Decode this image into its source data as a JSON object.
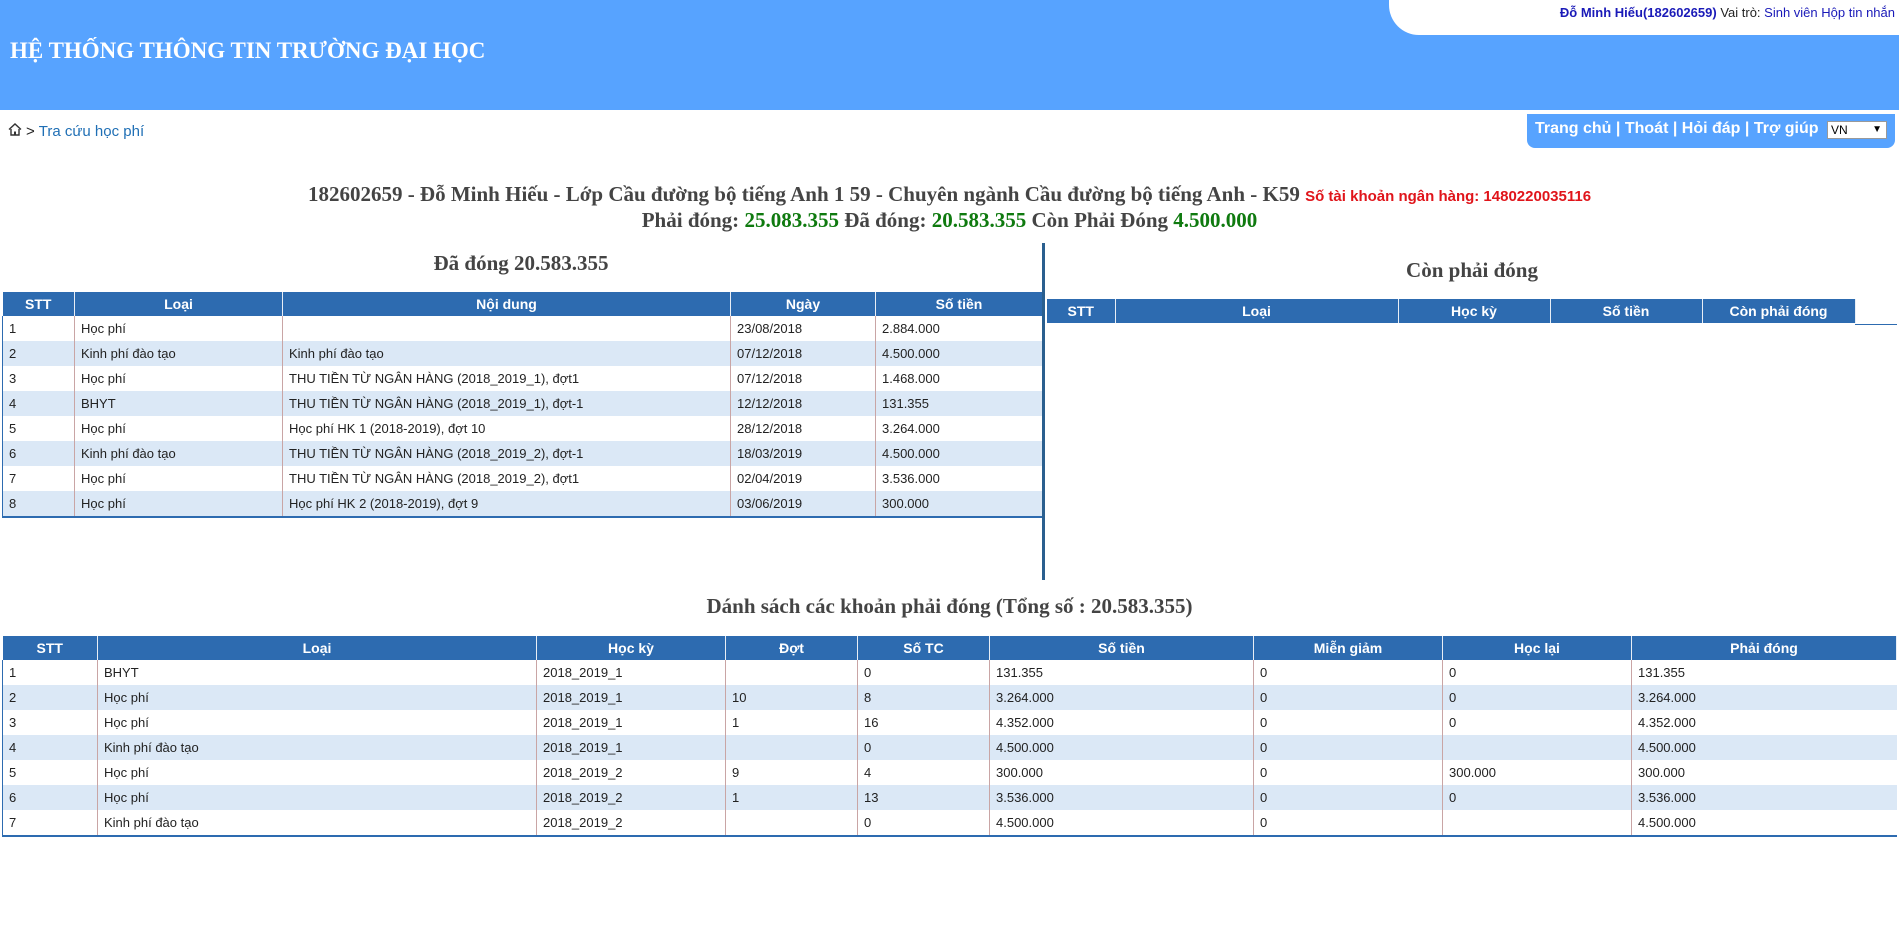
{
  "header": {
    "title": "HỆ THỐNG THÔNG TIN TRƯỜNG ĐẠI HỌC",
    "user_name": "Đỗ Minh Hiếu(182602659)",
    "role_label": "Vai trò:",
    "role_value": "Sinh viên",
    "inbox_link": "Hộp tin nhắn"
  },
  "breadcrumb": {
    "separator": ">",
    "current": "Tra cứu học phí",
    "home_icon": "home-icon"
  },
  "nav": {
    "home": "Trang chủ",
    "logout": "Thoát",
    "faq": "Hỏi đáp",
    "help": "Trợ giúp",
    "separator": "|",
    "language": "VN"
  },
  "summary": {
    "student_line": "182602659 - Đỗ Minh Hiếu - Lớp Cầu đường bộ tiếng Anh 1 59 - Chuyên ngành Cầu đường bộ tiếng Anh - K59",
    "bank_account": "Số tài khoản ngân hàng: 1480220035116",
    "must_pay_label": "Phải đóng:",
    "must_pay_value": "25.083.355",
    "paid_label": "Đã đóng:",
    "paid_value": "20.583.355",
    "remaining_label": "Còn Phải Đóng",
    "remaining_value": "4.500.000"
  },
  "paid_section": {
    "title": "Đã đóng 20.583.355",
    "columns": [
      "STT",
      "Loại",
      "Nội dung",
      "Ngày",
      "Số tiền"
    ],
    "rows": [
      [
        "1",
        "Học phí",
        "",
        "23/08/2018",
        "2.884.000"
      ],
      [
        "2",
        "Kinh phí đào tạo",
        "Kinh phí đào tạo",
        "07/12/2018",
        "4.500.000"
      ],
      [
        "3",
        "Học phí",
        "THU TIỀN TỪ NGÂN HÀNG (2018_2019_1), đợt1",
        "07/12/2018",
        "1.468.000"
      ],
      [
        "4",
        "BHYT",
        "THU TIỀN TỪ NGÂN HÀNG (2018_2019_1), đợt-1",
        "12/12/2018",
        "131.355"
      ],
      [
        "5",
        "Học phí",
        "Học phí HK 1 (2018-2019), đợt 10",
        "28/12/2018",
        "3.264.000"
      ],
      [
        "6",
        "Kinh phí đào tạo",
        "THU TIỀN TỪ NGÂN HÀNG (2018_2019_2), đợt-1",
        "18/03/2019",
        "4.500.000"
      ],
      [
        "7",
        "Học phí",
        "THU TIỀN TỪ NGÂN HÀNG (2018_2019_2), đợt1",
        "02/04/2019",
        "3.536.000"
      ],
      [
        "8",
        "Học phí",
        "Học phí HK 2 (2018-2019), đợt 9",
        "03/06/2019",
        "300.000"
      ]
    ]
  },
  "remaining_section": {
    "title": "Còn phải đóng",
    "columns": [
      "STT",
      "Loại",
      "Học kỳ",
      "Số tiền",
      "Còn phải đóng"
    ],
    "rows": []
  },
  "list_section": {
    "title": "Dánh sách các khoản phải đóng (Tổng số : 20.583.355)",
    "columns": [
      "STT",
      "Loại",
      "Học kỳ",
      "Đợt",
      "Số TC",
      "Số tiền",
      "Miễn giảm",
      "Học lại",
      "Phải đóng"
    ],
    "rows": [
      [
        "1",
        "BHYT",
        "2018_2019_1",
        "",
        "0",
        "131.355",
        "0",
        "0",
        "131.355"
      ],
      [
        "2",
        "Học phí",
        "2018_2019_1",
        "10",
        "8",
        "3.264.000",
        "0",
        "0",
        "3.264.000"
      ],
      [
        "3",
        "Học phí",
        "2018_2019_1",
        "1",
        "16",
        "4.352.000",
        "0",
        "0",
        "4.352.000"
      ],
      [
        "4",
        "Kinh phí đào tạo",
        "2018_2019_1",
        "",
        "0",
        "4.500.000",
        "0",
        "",
        "4.500.000"
      ],
      [
        "5",
        "Học phí",
        "2018_2019_2",
        "9",
        "4",
        "300.000",
        "0",
        "300.000",
        "300.000"
      ],
      [
        "6",
        "Học phí",
        "2018_2019_2",
        "1",
        "13",
        "3.536.000",
        "0",
        "0",
        "3.536.000"
      ],
      [
        "7",
        "Kinh phí đào tạo",
        "2018_2019_2",
        "",
        "0",
        "4.500.000",
        "0",
        "",
        "4.500.000"
      ]
    ]
  }
}
